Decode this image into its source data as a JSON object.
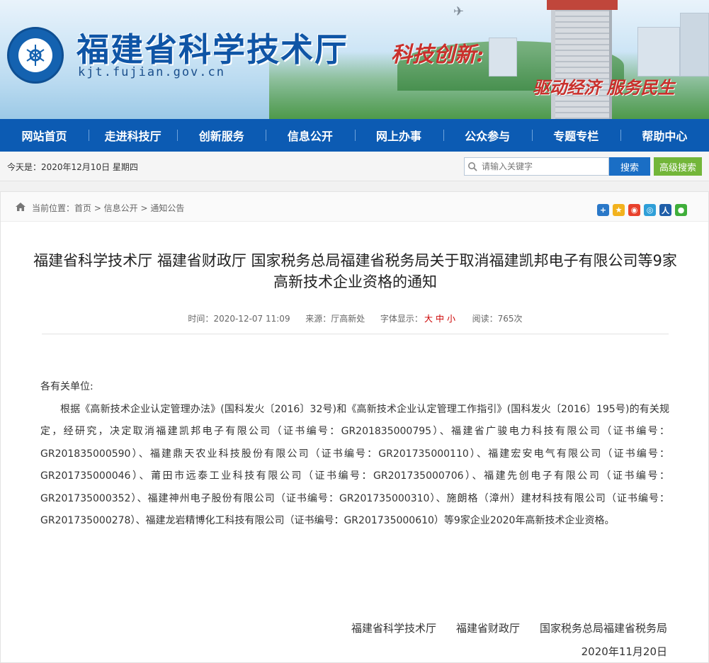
{
  "header": {
    "site_title": "福建省科学技术厅",
    "site_url": "kjt.fujian.gov.cn",
    "slogan_1": "科技创新:",
    "slogan_2": "驱动经济 服务民生"
  },
  "nav": [
    {
      "label": "网站首页"
    },
    {
      "label": "走进科技厅"
    },
    {
      "label": "创新服务"
    },
    {
      "label": "信息公开"
    },
    {
      "label": "网上办事"
    },
    {
      "label": "公众参与"
    },
    {
      "label": "专题专栏"
    },
    {
      "label": "帮助中心"
    }
  ],
  "infobar": {
    "today": "今天是：2020年12月10日  星期四",
    "search_placeholder": "请输入关键字",
    "search_button": "搜索",
    "advanced_button": "高级搜索"
  },
  "breadcrumb": {
    "text": "当前位置：首页 > 信息公开 > 通知公告"
  },
  "share_icons": [
    "plus-share-icon",
    "qzone-icon",
    "weibo-icon",
    "tencent-weibo-icon",
    "renren-icon",
    "wechat-icon"
  ],
  "article": {
    "title": "福建省科学技术厅 福建省财政厅 国家税务总局福建省税务局关于取消福建凯邦电子有限公司等9家高新技术企业资格的通知",
    "time_label": "时间：",
    "time": "2020-12-07 11:09",
    "source_label": "来源：",
    "source": "厅高新处",
    "font_label": "字体显示：",
    "font_large": "大",
    "font_medium": "中",
    "font_small": "小",
    "views_label": "阅读：",
    "views": "765次",
    "salutation": "各有关单位:",
    "paragraph": "根据《高新技术企业认定管理办法》(国科发火〔2016〕32号)和《高新技术企业认定管理工作指引》(国科发火〔2016〕195号)的有关规定，经研究，决定取消福建凯邦电子有限公司（证书编号：GR201835000795）、福建省广骏电力科技有限公司（证书编号：GR201835000590）、福建鼎天农业科技股份有限公司（证书编号：GR201735000110）、福建宏安电气有限公司（证书编号：GR201735000046）、莆田市远泰工业科技有限公司（证书编号：GR201735000706）、福建先创电子有限公司（证书编号：GR201735000352）、福建神州电子股份有限公司（证书编号：GR201735000310）、施朗格（漳州）建材科技有限公司（证书编号：GR201735000278）、福建龙岩精博化工科技有限公司（证书编号：GR201735000610）等9家企业2020年高新技术企业资格。",
    "signatories": [
      "福建省科学技术厅",
      "福建省财政厅",
      "国家税务总局福建省税务局"
    ],
    "date": "2020年11月20日"
  }
}
